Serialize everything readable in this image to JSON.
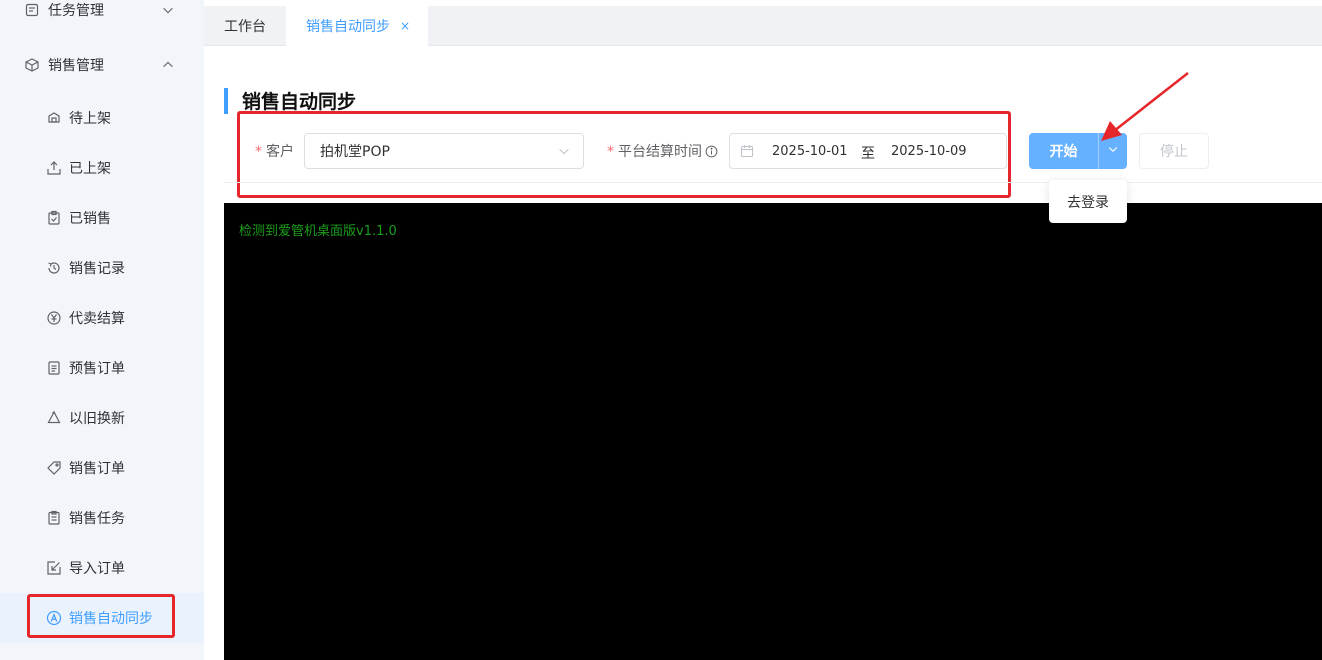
{
  "sidebar": {
    "groups": [
      {
        "label": "任务管理",
        "icon": "task-icon",
        "expanded": false
      },
      {
        "label": "销售管理",
        "icon": "package-icon",
        "expanded": true
      }
    ],
    "items": [
      {
        "label": "待上架",
        "icon": "pending-shelf-icon"
      },
      {
        "label": "已上架",
        "icon": "upload-icon"
      },
      {
        "label": "已销售",
        "icon": "clipboard-check-icon"
      },
      {
        "label": "销售记录",
        "icon": "history-icon"
      },
      {
        "label": "代卖结算",
        "icon": "yen-circle-icon"
      },
      {
        "label": "预售订单",
        "icon": "document-icon"
      },
      {
        "label": "以旧换新",
        "icon": "recycle-icon"
      },
      {
        "label": "销售订单",
        "icon": "tag-icon"
      },
      {
        "label": "销售任务",
        "icon": "clipboard-list-icon"
      },
      {
        "label": "导入订单",
        "icon": "import-icon"
      },
      {
        "label": "销售自动同步",
        "icon": "auto-a-icon",
        "active": true
      }
    ]
  },
  "tabs": [
    {
      "label": "工作台"
    },
    {
      "label": "销售自动同步",
      "close": "×",
      "active": true
    }
  ],
  "page": {
    "title": "销售自动同步"
  },
  "form": {
    "required_mark": "*",
    "customer_label": "客户",
    "customer_value": "拍机堂POP",
    "settle_label": "平台结算时间",
    "date_start": "2025-10-01",
    "date_sep": "至",
    "date_end": "2025-10-09"
  },
  "actions": {
    "start_label": "开始",
    "stop_label": "停止",
    "dropdown_item": "去登录"
  },
  "console": {
    "lines": [
      "检测到爱管机桌面版v1.1.0"
    ]
  },
  "colors": {
    "accent": "#409eff",
    "annotation": "#e5262a",
    "console_bg": "#000000",
    "console_text": "#1b9e1b"
  }
}
